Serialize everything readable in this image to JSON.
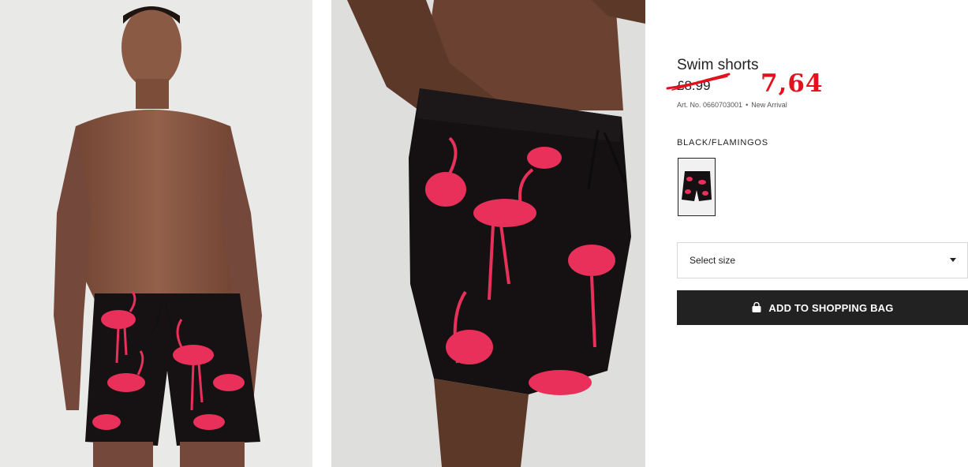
{
  "product": {
    "title": "Swim shorts",
    "old_price": "£8.99",
    "new_price": "7,64",
    "art_no": "Art. No. 0660703001",
    "badge": "New Arrival"
  },
  "color": {
    "label": "BLACK/FLAMINGOS"
  },
  "size_select": {
    "label": "Select size"
  },
  "add_to_bag": {
    "label": "ADD TO SHOPPING BAG"
  },
  "colors": {
    "accent_red": "#e3111e",
    "button_bg": "#222222",
    "flamingo_pink": "#e8305a"
  },
  "icons": {
    "bag": "shopping-bag-icon",
    "dropdown": "chevron-down-icon"
  }
}
